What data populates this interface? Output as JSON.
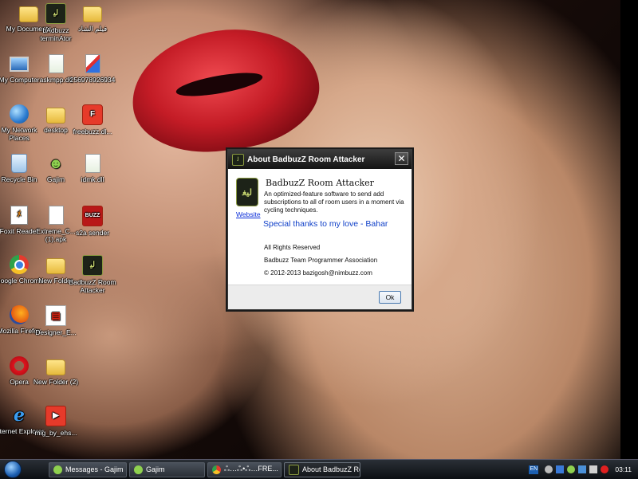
{
  "desktop_icons": [
    {
      "label": "My Documents",
      "icon": "folder-icon"
    },
    {
      "label": "bAdbuzz terminAtor",
      "icon": "app-icon"
    },
    {
      "label": "فيلم الشاد",
      "icon": "folder-icon"
    },
    {
      "label": "My Computer",
      "icon": "computer-icon"
    },
    {
      "label": "askmpp.dll",
      "icon": "dll-file-icon"
    },
    {
      "label": "256978926934",
      "icon": "image-file-icon"
    },
    {
      "label": "My Network Places",
      "icon": "network-icon"
    },
    {
      "label": "desktop",
      "icon": "folder-icon"
    },
    {
      "label": "freebuzz.dl...",
      "icon": "flash-file-icon"
    },
    {
      "label": "Recycle Bin",
      "icon": "recycle-bin-icon"
    },
    {
      "label": "Gajim",
      "icon": "gajim-icon"
    },
    {
      "label": "idmk.dll",
      "icon": "dll-file-icon"
    },
    {
      "label": "Foxit Reader",
      "icon": "foxit-icon"
    },
    {
      "label": "Extreme_C... (1).apk",
      "icon": "apk-file-icon"
    },
    {
      "label": "s2a sender",
      "icon": "sender-app-icon"
    },
    {
      "label": "Google Chrome",
      "icon": "chrome-icon"
    },
    {
      "label": "New Folder",
      "icon": "folder-icon"
    },
    {
      "label": "BadbuzZ Room Attacker",
      "icon": "app-icon"
    },
    {
      "label": "Mozilla Firefox",
      "icon": "firefox-icon"
    },
    {
      "label": "Designer_E...",
      "icon": "pdf-file-icon"
    },
    {
      "label": "Opera",
      "icon": "opera-icon"
    },
    {
      "label": "New Folder (2)",
      "icon": "folder-icon"
    },
    {
      "label": "Internet Explorer",
      "icon": "ie-icon"
    },
    {
      "label": "mig_by_ehs...",
      "icon": "video-file-icon"
    }
  ],
  "dialog": {
    "title": "About BadbuzZ Room Attacker",
    "close_glyph": "✕",
    "logo_text": "ﻟﯿﻐ",
    "website_label": "Website",
    "app_name": "BadbuzZ Room Attacker",
    "description": "An optimized-feature software to send add subscriptions to all of room users in a moment via cycling techniques.",
    "thanks": "Special thanks to my love - Bahar",
    "rights": "All Rights Reserved",
    "team": "Badbuzz Team Programmer Association",
    "copyright": "©  2012-2013  bazigosh@nimbuzz.com",
    "ok_label": "Ok"
  },
  "taskbar": {
    "buttons": [
      {
        "label": "Messages - Gajim",
        "icon": "gajim-icon"
      },
      {
        "label": "Gajim",
        "icon": "gajim-icon"
      },
      {
        "label": "ஃ…ஃ•ஃ…FRE...",
        "icon": "chrome-icon"
      },
      {
        "label": "About BadbuzZ Room...",
        "icon": "app-icon"
      }
    ],
    "language": "EN",
    "clock": "03:11"
  }
}
